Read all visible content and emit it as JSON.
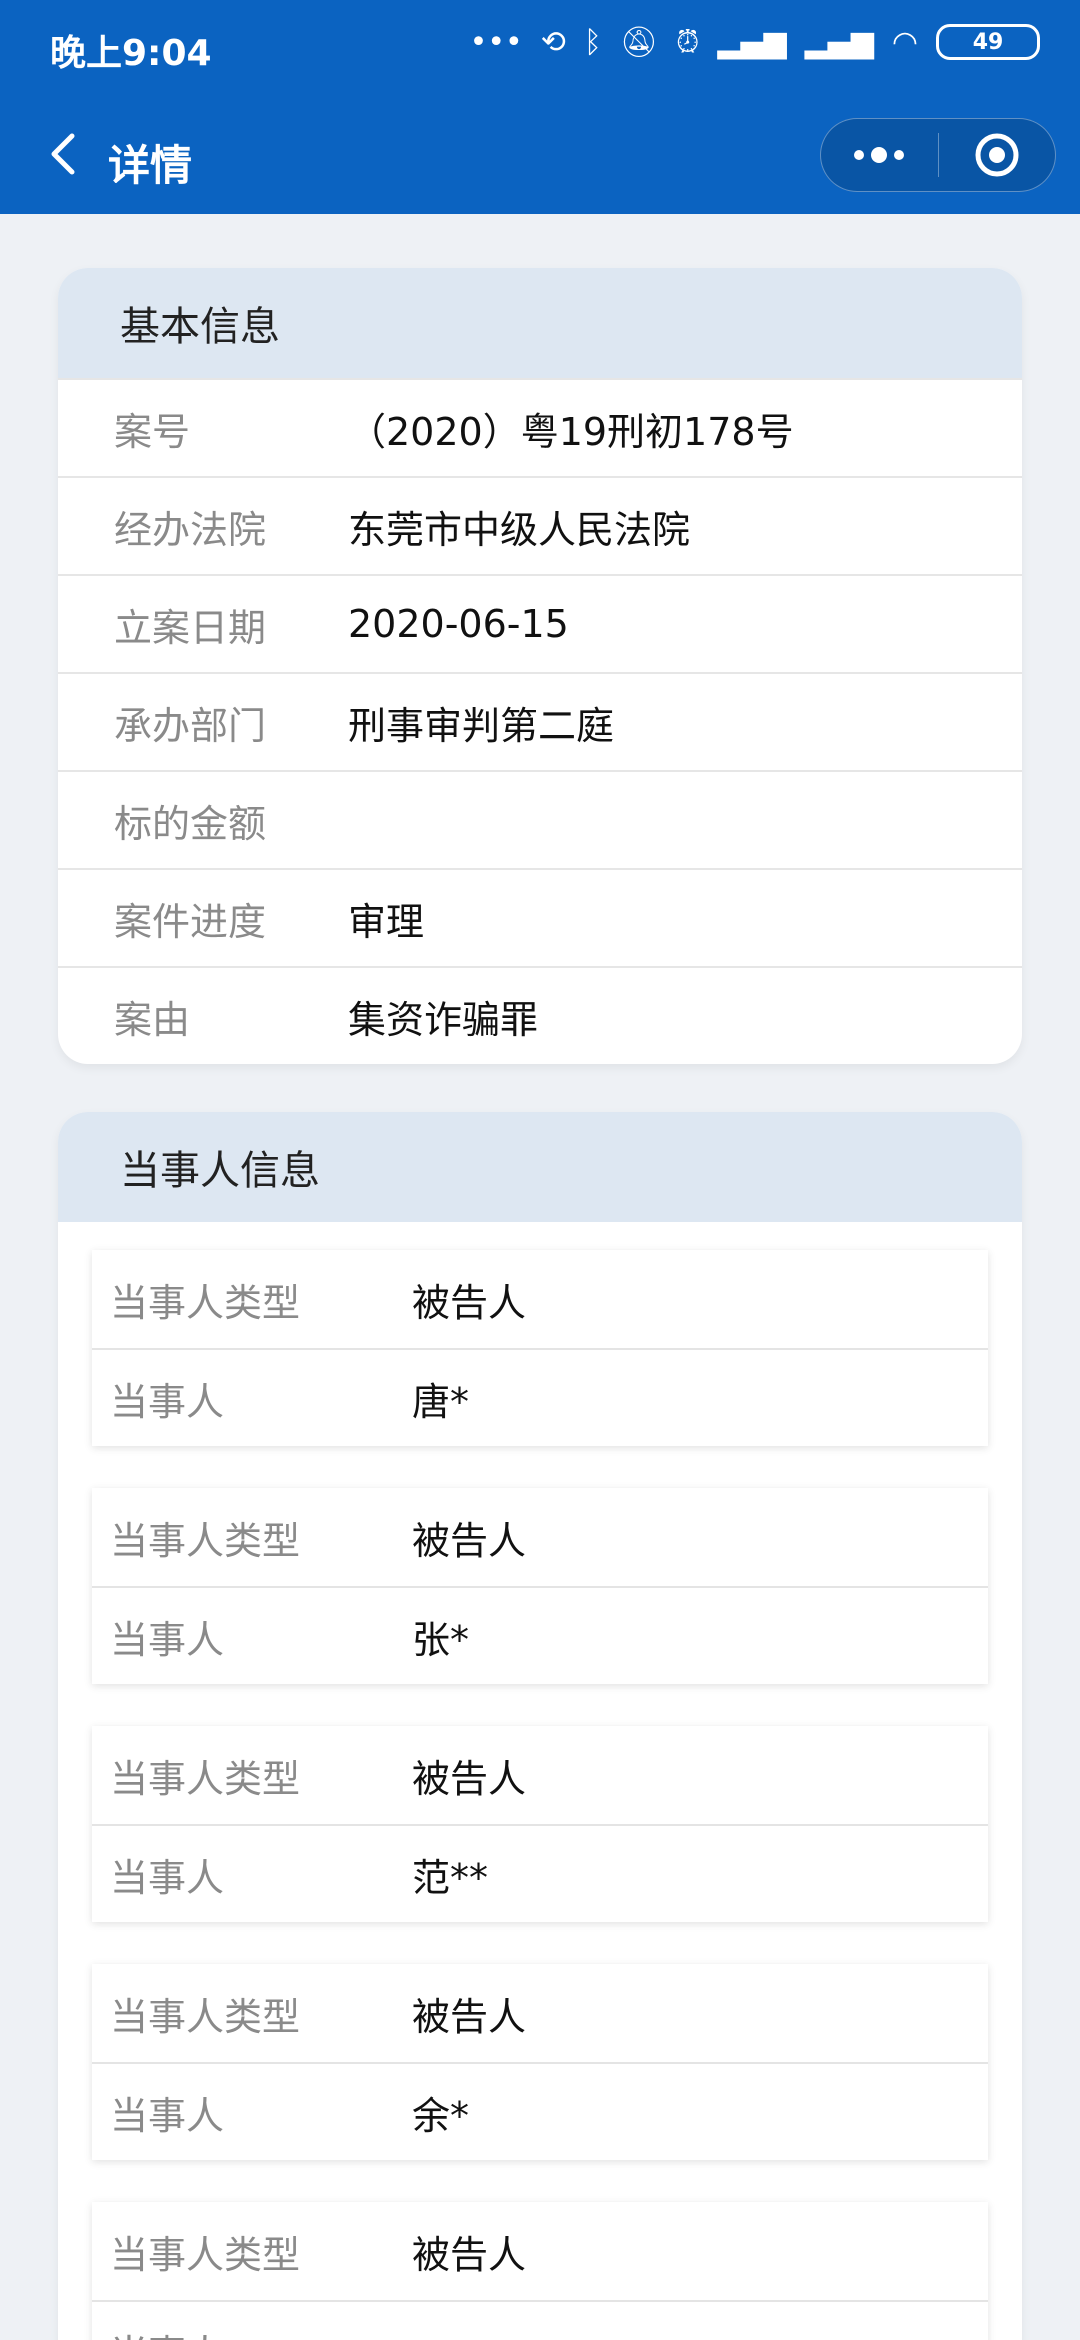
{
  "status_bar": {
    "time": "晚上9:04",
    "battery": "49"
  },
  "nav": {
    "title": "详情"
  },
  "basic_info": {
    "header": "基本信息",
    "rows": [
      {
        "label": "案号",
        "value": "（2020）粤19刑初178号"
      },
      {
        "label": "经办法院",
        "value": "东莞市中级人民法院"
      },
      {
        "label": "立案日期",
        "value": "2020-06-15"
      },
      {
        "label": "承办部门",
        "value": "刑事审判第二庭"
      },
      {
        "label": "标的金额",
        "value": ""
      },
      {
        "label": "案件进度",
        "value": "审理"
      },
      {
        "label": "案由",
        "value": "集资诈骗罪"
      }
    ]
  },
  "parties": {
    "header": "当事人信息",
    "items": [
      {
        "type_label": "当事人类型",
        "type_value": "被告人",
        "name_label": "当事人",
        "name_value": "唐*"
      },
      {
        "type_label": "当事人类型",
        "type_value": "被告人",
        "name_label": "当事人",
        "name_value": "张*"
      },
      {
        "type_label": "当事人类型",
        "type_value": "被告人",
        "name_label": "当事人",
        "name_value": "范**"
      },
      {
        "type_label": "当事人类型",
        "type_value": "被告人",
        "name_label": "当事人",
        "name_value": "余*"
      },
      {
        "type_label": "当事人类型",
        "type_value": "被告人",
        "name_label": "当事人",
        "name_value": ""
      }
    ]
  },
  "colors": {
    "brand_blue": "#0b63c1",
    "header_bg": "#dde7f2",
    "page_bg": "#eef1f5"
  }
}
